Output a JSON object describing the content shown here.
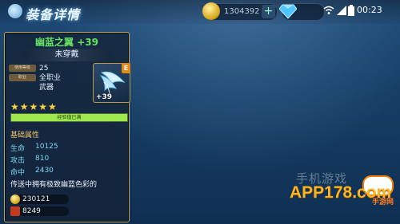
{
  "header": {
    "title": "装备详情",
    "gold": "1304392",
    "gold_add": "+",
    "time": "00:23"
  },
  "item": {
    "name": "幽蓝之翼",
    "enhance": "+39",
    "equip_status": "未穿戴",
    "tag_level": "使用等级",
    "tag_class": "职业",
    "level": "25",
    "class": "全职业",
    "type": "武器",
    "grade_badge": "E",
    "icon_enhance": "+39",
    "stars": "★★★★★",
    "progress_label": "经验值已满",
    "progress": 1.0,
    "section_title": "基础属性",
    "stats": [
      {
        "label": "生命",
        "value": "10125"
      },
      {
        "label": "攻击",
        "value": "810"
      },
      {
        "label": "命中",
        "value": "2430"
      }
    ],
    "description": "传送中拥有极致幽蓝色彩的",
    "cost_a": "230121",
    "cost_b": "8249"
  },
  "watermark": {
    "cn": "手机游戏",
    "app": "APP178.com",
    "sub": "手游网"
  },
  "icons": [
    "gold-coin-icon",
    "add-icon",
    "diamond-icon",
    "wifi-icon",
    "signal-icon",
    "battery-icon",
    "wing-icon"
  ],
  "colors": {
    "name": "#66e060",
    "stat": "#7fd3f4",
    "border": "#c4a258",
    "progress": "#9ee84d"
  }
}
